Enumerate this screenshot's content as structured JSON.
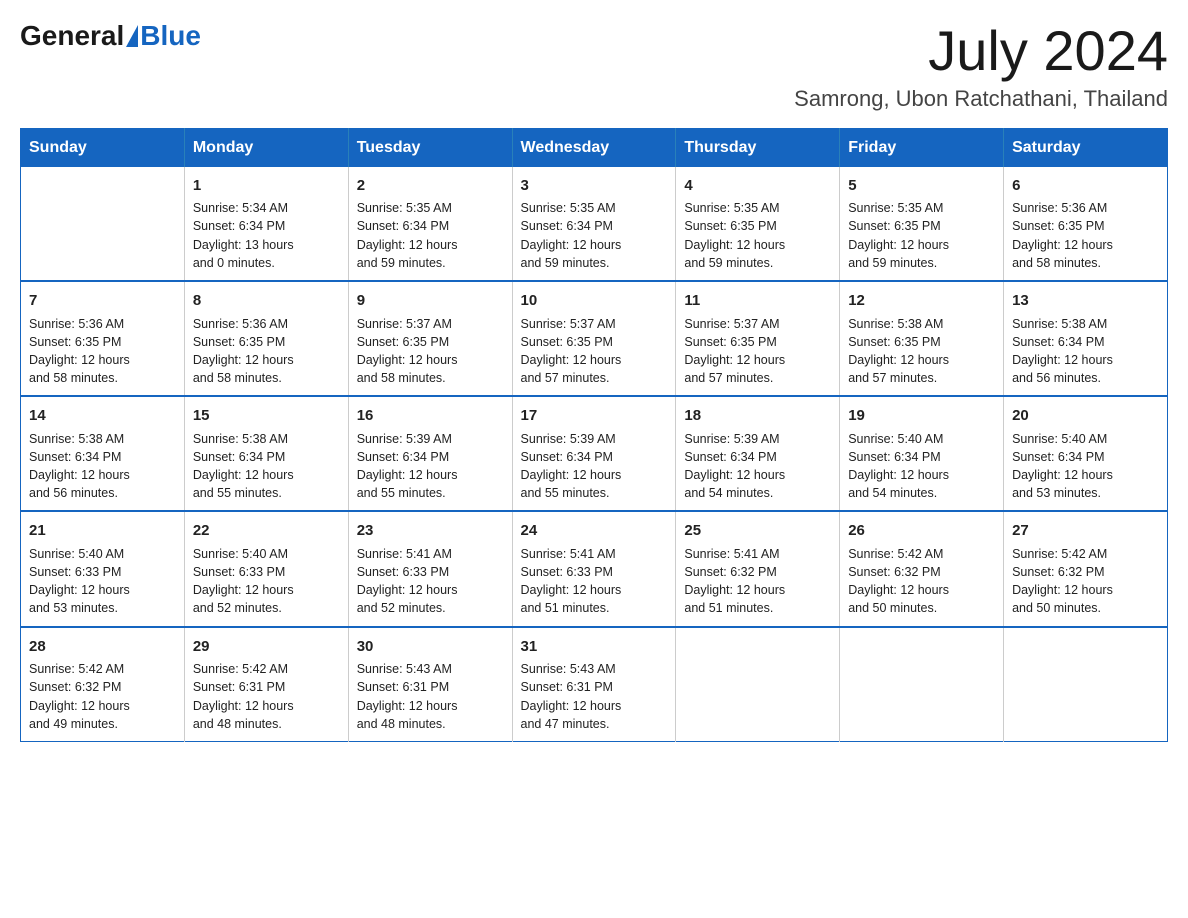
{
  "logo": {
    "general": "General",
    "blue": "Blue"
  },
  "title": "July 2024",
  "location": "Samrong, Ubon Ratchathani, Thailand",
  "headers": [
    "Sunday",
    "Monday",
    "Tuesday",
    "Wednesday",
    "Thursday",
    "Friday",
    "Saturday"
  ],
  "weeks": [
    [
      {
        "day": "",
        "info": ""
      },
      {
        "day": "1",
        "info": "Sunrise: 5:34 AM\nSunset: 6:34 PM\nDaylight: 13 hours\nand 0 minutes."
      },
      {
        "day": "2",
        "info": "Sunrise: 5:35 AM\nSunset: 6:34 PM\nDaylight: 12 hours\nand 59 minutes."
      },
      {
        "day": "3",
        "info": "Sunrise: 5:35 AM\nSunset: 6:34 PM\nDaylight: 12 hours\nand 59 minutes."
      },
      {
        "day": "4",
        "info": "Sunrise: 5:35 AM\nSunset: 6:35 PM\nDaylight: 12 hours\nand 59 minutes."
      },
      {
        "day": "5",
        "info": "Sunrise: 5:35 AM\nSunset: 6:35 PM\nDaylight: 12 hours\nand 59 minutes."
      },
      {
        "day": "6",
        "info": "Sunrise: 5:36 AM\nSunset: 6:35 PM\nDaylight: 12 hours\nand 58 minutes."
      }
    ],
    [
      {
        "day": "7",
        "info": "Sunrise: 5:36 AM\nSunset: 6:35 PM\nDaylight: 12 hours\nand 58 minutes."
      },
      {
        "day": "8",
        "info": "Sunrise: 5:36 AM\nSunset: 6:35 PM\nDaylight: 12 hours\nand 58 minutes."
      },
      {
        "day": "9",
        "info": "Sunrise: 5:37 AM\nSunset: 6:35 PM\nDaylight: 12 hours\nand 58 minutes."
      },
      {
        "day": "10",
        "info": "Sunrise: 5:37 AM\nSunset: 6:35 PM\nDaylight: 12 hours\nand 57 minutes."
      },
      {
        "day": "11",
        "info": "Sunrise: 5:37 AM\nSunset: 6:35 PM\nDaylight: 12 hours\nand 57 minutes."
      },
      {
        "day": "12",
        "info": "Sunrise: 5:38 AM\nSunset: 6:35 PM\nDaylight: 12 hours\nand 57 minutes."
      },
      {
        "day": "13",
        "info": "Sunrise: 5:38 AM\nSunset: 6:34 PM\nDaylight: 12 hours\nand 56 minutes."
      }
    ],
    [
      {
        "day": "14",
        "info": "Sunrise: 5:38 AM\nSunset: 6:34 PM\nDaylight: 12 hours\nand 56 minutes."
      },
      {
        "day": "15",
        "info": "Sunrise: 5:38 AM\nSunset: 6:34 PM\nDaylight: 12 hours\nand 55 minutes."
      },
      {
        "day": "16",
        "info": "Sunrise: 5:39 AM\nSunset: 6:34 PM\nDaylight: 12 hours\nand 55 minutes."
      },
      {
        "day": "17",
        "info": "Sunrise: 5:39 AM\nSunset: 6:34 PM\nDaylight: 12 hours\nand 55 minutes."
      },
      {
        "day": "18",
        "info": "Sunrise: 5:39 AM\nSunset: 6:34 PM\nDaylight: 12 hours\nand 54 minutes."
      },
      {
        "day": "19",
        "info": "Sunrise: 5:40 AM\nSunset: 6:34 PM\nDaylight: 12 hours\nand 54 minutes."
      },
      {
        "day": "20",
        "info": "Sunrise: 5:40 AM\nSunset: 6:34 PM\nDaylight: 12 hours\nand 53 minutes."
      }
    ],
    [
      {
        "day": "21",
        "info": "Sunrise: 5:40 AM\nSunset: 6:33 PM\nDaylight: 12 hours\nand 53 minutes."
      },
      {
        "day": "22",
        "info": "Sunrise: 5:40 AM\nSunset: 6:33 PM\nDaylight: 12 hours\nand 52 minutes."
      },
      {
        "day": "23",
        "info": "Sunrise: 5:41 AM\nSunset: 6:33 PM\nDaylight: 12 hours\nand 52 minutes."
      },
      {
        "day": "24",
        "info": "Sunrise: 5:41 AM\nSunset: 6:33 PM\nDaylight: 12 hours\nand 51 minutes."
      },
      {
        "day": "25",
        "info": "Sunrise: 5:41 AM\nSunset: 6:32 PM\nDaylight: 12 hours\nand 51 minutes."
      },
      {
        "day": "26",
        "info": "Sunrise: 5:42 AM\nSunset: 6:32 PM\nDaylight: 12 hours\nand 50 minutes."
      },
      {
        "day": "27",
        "info": "Sunrise: 5:42 AM\nSunset: 6:32 PM\nDaylight: 12 hours\nand 50 minutes."
      }
    ],
    [
      {
        "day": "28",
        "info": "Sunrise: 5:42 AM\nSunset: 6:32 PM\nDaylight: 12 hours\nand 49 minutes."
      },
      {
        "day": "29",
        "info": "Sunrise: 5:42 AM\nSunset: 6:31 PM\nDaylight: 12 hours\nand 48 minutes."
      },
      {
        "day": "30",
        "info": "Sunrise: 5:43 AM\nSunset: 6:31 PM\nDaylight: 12 hours\nand 48 minutes."
      },
      {
        "day": "31",
        "info": "Sunrise: 5:43 AM\nSunset: 6:31 PM\nDaylight: 12 hours\nand 47 minutes."
      },
      {
        "day": "",
        "info": ""
      },
      {
        "day": "",
        "info": ""
      },
      {
        "day": "",
        "info": ""
      }
    ]
  ]
}
